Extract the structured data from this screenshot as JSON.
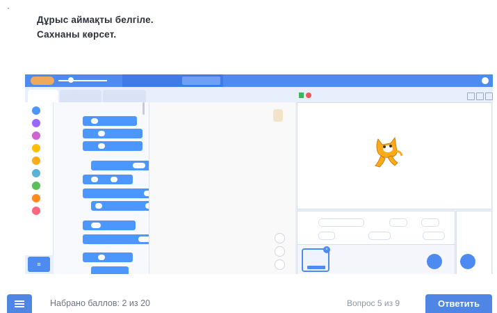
{
  "question": {
    "line1": "Дұрыс аймақты белгіле.",
    "line2": "Сахнаны көрсет."
  },
  "footer": {
    "score": "Набрано баллов: 2 из 20",
    "question_counter": "Вопрос 5 из 9",
    "answer_button": "Ответить"
  },
  "screenshot": {
    "app": "Scratch editor",
    "colors": {
      "accent": "#4d8bf0",
      "motion_block": "#4c97ff",
      "green_flag": "#3cb55a",
      "stop": "#ec5959"
    }
  },
  "icons": {
    "list_button": "menu-list-icon",
    "green_flag": "green-flag-icon",
    "stop": "stop-icon",
    "sprite": "cat-sprite-icon"
  }
}
